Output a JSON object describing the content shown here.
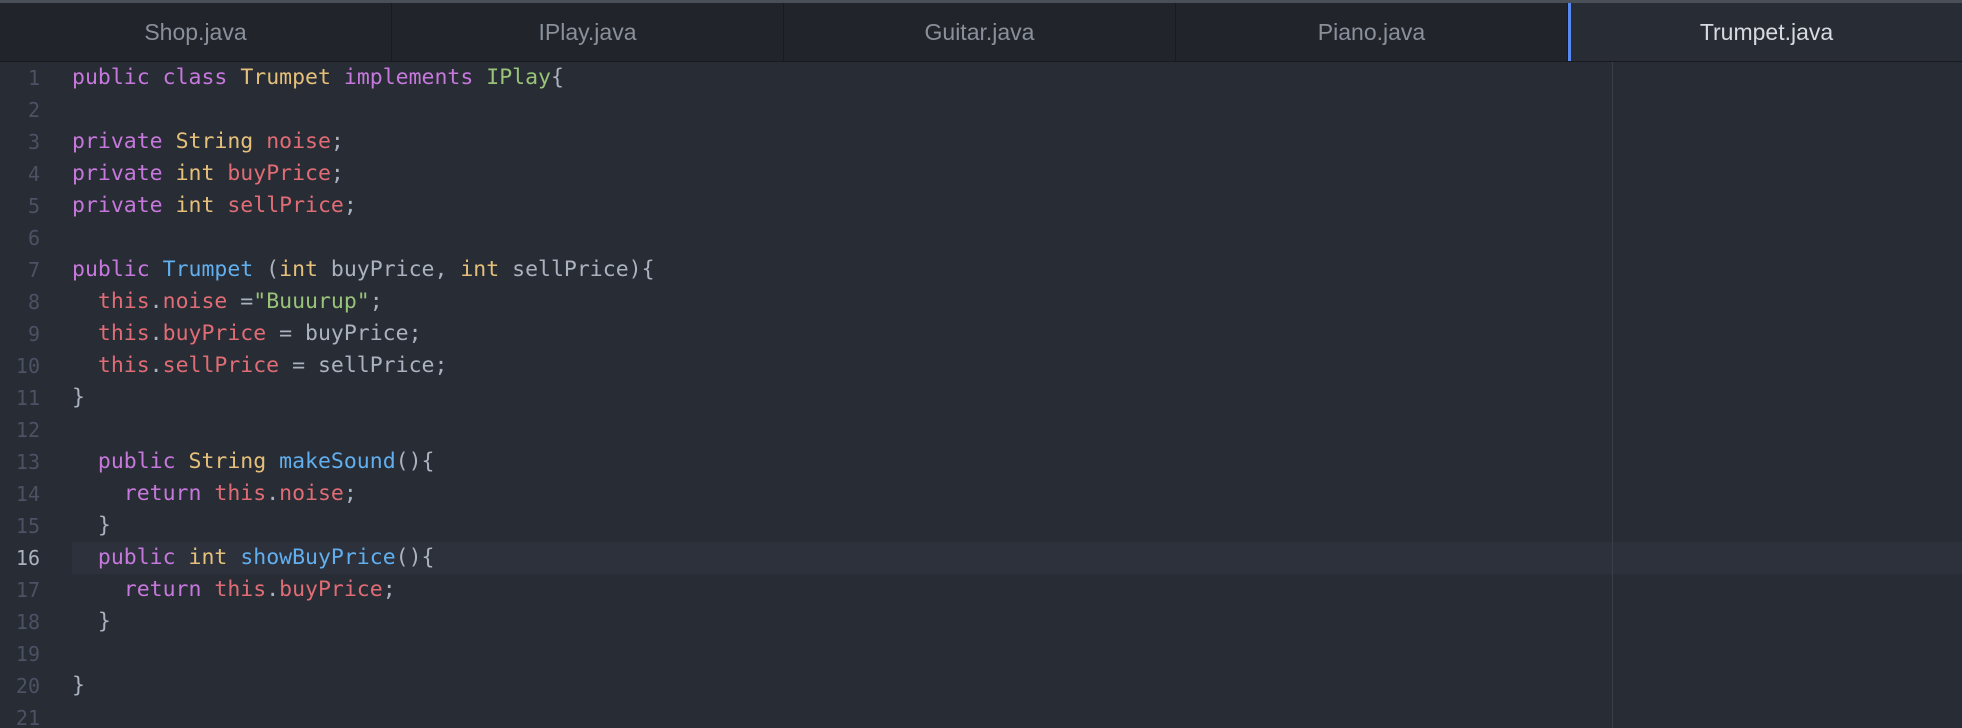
{
  "tabs": [
    {
      "label": "Shop.java",
      "active": false
    },
    {
      "label": "IPlay.java",
      "active": false
    },
    {
      "label": "Guitar.java",
      "active": false
    },
    {
      "label": "Piano.java",
      "active": false
    },
    {
      "label": "Trumpet.java",
      "active": true
    }
  ],
  "editor": {
    "cursor_line": 16,
    "lines": [
      {
        "n": "1",
        "tokens": [
          [
            "kw",
            "public"
          ],
          [
            "plain",
            " "
          ],
          [
            "kw",
            "class"
          ],
          [
            "plain",
            " "
          ],
          [
            "type",
            "Trumpet"
          ],
          [
            "plain",
            " "
          ],
          [
            "kw",
            "implements"
          ],
          [
            "plain",
            " "
          ],
          [
            "iface",
            "IPlay"
          ],
          [
            "plain",
            "{"
          ]
        ]
      },
      {
        "n": "2",
        "tokens": []
      },
      {
        "n": "3",
        "tokens": [
          [
            "kw",
            "private"
          ],
          [
            "plain",
            " "
          ],
          [
            "type",
            "String"
          ],
          [
            "plain",
            " "
          ],
          [
            "prop",
            "noise"
          ],
          [
            "plain",
            ";"
          ]
        ]
      },
      {
        "n": "4",
        "tokens": [
          [
            "kw",
            "private"
          ],
          [
            "plain",
            " "
          ],
          [
            "type",
            "int"
          ],
          [
            "plain",
            " "
          ],
          [
            "prop",
            "buyPrice"
          ],
          [
            "plain",
            ";"
          ]
        ]
      },
      {
        "n": "5",
        "tokens": [
          [
            "kw",
            "private"
          ],
          [
            "plain",
            " "
          ],
          [
            "type",
            "int"
          ],
          [
            "plain",
            " "
          ],
          [
            "prop",
            "sellPrice"
          ],
          [
            "plain",
            ";"
          ]
        ]
      },
      {
        "n": "6",
        "tokens": []
      },
      {
        "n": "7",
        "tokens": [
          [
            "kw",
            "public"
          ],
          [
            "plain",
            " "
          ],
          [
            "fn",
            "Trumpet"
          ],
          [
            "plain",
            " ("
          ],
          [
            "type",
            "int"
          ],
          [
            "plain",
            " buyPrice, "
          ],
          [
            "type",
            "int"
          ],
          [
            "plain",
            " sellPrice){"
          ]
        ]
      },
      {
        "n": "8",
        "tokens": [
          [
            "plain",
            "  "
          ],
          [
            "prop",
            "this"
          ],
          [
            "plain",
            "."
          ],
          [
            "prop",
            "noise"
          ],
          [
            "plain",
            " ="
          ],
          [
            "str",
            "\"Buuurup\""
          ],
          [
            "plain",
            ";"
          ]
        ]
      },
      {
        "n": "9",
        "tokens": [
          [
            "plain",
            "  "
          ],
          [
            "prop",
            "this"
          ],
          [
            "plain",
            "."
          ],
          [
            "prop",
            "buyPrice"
          ],
          [
            "plain",
            " = buyPrice;"
          ]
        ]
      },
      {
        "n": "10",
        "tokens": [
          [
            "plain",
            "  "
          ],
          [
            "prop",
            "this"
          ],
          [
            "plain",
            "."
          ],
          [
            "prop",
            "sellPrice"
          ],
          [
            "plain",
            " = sellPrice;"
          ]
        ]
      },
      {
        "n": "11",
        "tokens": [
          [
            "plain",
            "}"
          ]
        ]
      },
      {
        "n": "12",
        "tokens": []
      },
      {
        "n": "13",
        "tokens": [
          [
            "plain",
            "  "
          ],
          [
            "kw",
            "public"
          ],
          [
            "plain",
            " "
          ],
          [
            "type",
            "String"
          ],
          [
            "plain",
            " "
          ],
          [
            "fn",
            "makeSound"
          ],
          [
            "plain",
            "(){"
          ]
        ]
      },
      {
        "n": "14",
        "tokens": [
          [
            "plain",
            "    "
          ],
          [
            "kw",
            "return"
          ],
          [
            "plain",
            " "
          ],
          [
            "prop",
            "this"
          ],
          [
            "plain",
            "."
          ],
          [
            "prop",
            "noise"
          ],
          [
            "plain",
            ";"
          ]
        ]
      },
      {
        "n": "15",
        "tokens": [
          [
            "plain",
            "  }"
          ]
        ]
      },
      {
        "n": "16",
        "tokens": [
          [
            "plain",
            "  "
          ],
          [
            "kw",
            "public"
          ],
          [
            "plain",
            " "
          ],
          [
            "type",
            "int"
          ],
          [
            "plain",
            " "
          ],
          [
            "fn",
            "showBuyPrice"
          ],
          [
            "plain",
            "(){"
          ]
        ]
      },
      {
        "n": "17",
        "tokens": [
          [
            "plain",
            "    "
          ],
          [
            "kw",
            "return"
          ],
          [
            "plain",
            " "
          ],
          [
            "prop",
            "this"
          ],
          [
            "plain",
            "."
          ],
          [
            "prop",
            "buyPrice"
          ],
          [
            "plain",
            ";"
          ]
        ]
      },
      {
        "n": "18",
        "tokens": [
          [
            "plain",
            "  }"
          ]
        ]
      },
      {
        "n": "19",
        "tokens": []
      },
      {
        "n": "20",
        "tokens": [
          [
            "plain",
            "}"
          ]
        ]
      },
      {
        "n": "21",
        "tokens": []
      }
    ]
  }
}
